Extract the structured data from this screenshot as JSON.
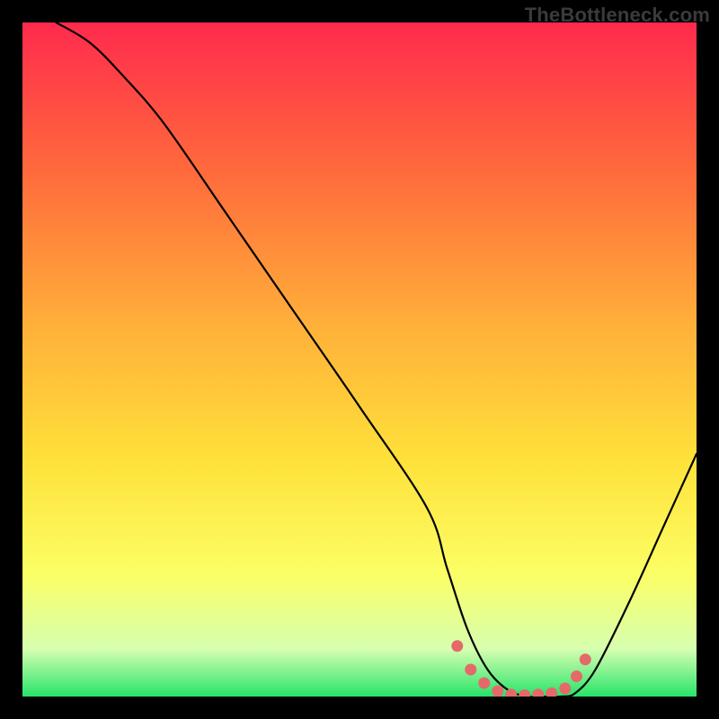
{
  "watermark": "TheBottleneck.com",
  "colors": {
    "frame_bg": "#000000",
    "curve_stroke": "#000000",
    "dot_fill": "#e46a6a",
    "gradient_top": "#ff2a4d",
    "gradient_mid1": "#ff6a3c",
    "gradient_mid2": "#ffb03a",
    "gradient_mid3": "#ffe13a",
    "gradient_mid4": "#fbff66",
    "gradient_mid5": "#d6ffb0",
    "gradient_bottom": "#27e36a"
  },
  "chart_data": {
    "type": "line",
    "title": "",
    "xlabel": "",
    "ylabel": "",
    "xlim": [
      0,
      100
    ],
    "ylim": [
      0,
      100
    ],
    "curve": {
      "x": [
        5,
        10,
        15,
        21,
        30,
        40,
        50,
        60,
        63,
        66,
        69,
        72,
        75,
        78,
        80,
        82,
        85,
        90,
        95,
        100
      ],
      "y": [
        100,
        97,
        92,
        85,
        72,
        57.5,
        43,
        28,
        19,
        10,
        4,
        1,
        0,
        0,
        0,
        0.5,
        4,
        14,
        25,
        36
      ]
    },
    "highlight_dots": {
      "x": [
        64.5,
        66.5,
        68.5,
        70.5,
        72.5,
        74.5,
        76.5,
        78.5,
        80.5,
        82.2,
        83.5
      ],
      "y": [
        7.5,
        4.0,
        2.0,
        0.8,
        0.3,
        0.2,
        0.3,
        0.5,
        1.2,
        3.0,
        5.5
      ]
    }
  }
}
